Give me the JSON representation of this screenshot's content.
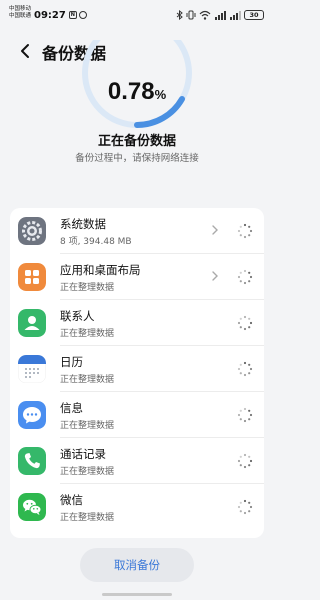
{
  "status_bar": {
    "carrier1": "中国移动",
    "carrier2": "中国联通",
    "time": "09:27",
    "mini_icon1": "N",
    "battery": "30"
  },
  "header": {
    "title": "备份数据"
  },
  "progress": {
    "number": "0.78",
    "percent_sign": "%",
    "fraction": 0.0078
  },
  "status": {
    "title": "正在备份数据",
    "subtitle": "备份过程中，请保持网络连接"
  },
  "items": [
    {
      "name": "系统数据",
      "sub": "8 项, 394.48 MB",
      "icon": "settings-gear-icon",
      "chevron": true
    },
    {
      "name": "应用和桌面布局",
      "sub": "正在整理数据",
      "icon": "apps-grid-icon",
      "chevron": true
    },
    {
      "name": "联系人",
      "sub": "正在整理数据",
      "icon": "contacts-icon",
      "chevron": false
    },
    {
      "name": "日历",
      "sub": "正在整理数据",
      "icon": "calendar-icon",
      "chevron": false
    },
    {
      "name": "信息",
      "sub": "正在整理数据",
      "icon": "messages-icon",
      "chevron": false
    },
    {
      "name": "通话记录",
      "sub": "正在整理数据",
      "icon": "phone-icon",
      "chevron": false
    },
    {
      "name": "微信",
      "sub": "正在整理数据",
      "icon": "wechat-icon",
      "chevron": false
    }
  ],
  "cancel_label": "取消备份",
  "colors": {
    "accent": "#3a78d8",
    "ring": "#4a90e2"
  }
}
